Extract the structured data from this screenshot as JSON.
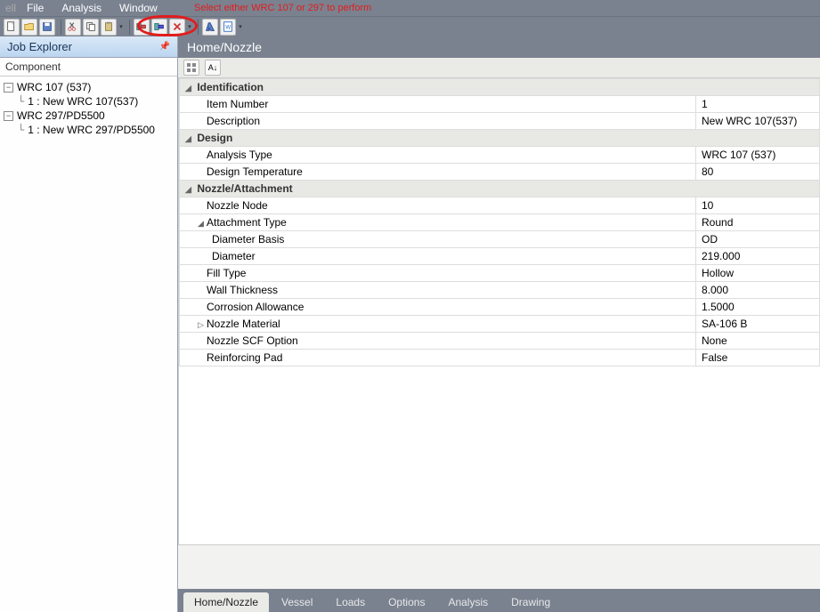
{
  "menu": {
    "items": [
      "File",
      "Analysis",
      "Window"
    ],
    "prefix": "ell"
  },
  "overlay_text": "Select either WRC 107 or 297 to perform",
  "job_explorer": {
    "title": "Job Explorer",
    "component_label": "Component",
    "nodes": [
      {
        "label": "WRC 107 (537)",
        "child": "1 : New WRC 107(537)"
      },
      {
        "label": "WRC 297/PD5500",
        "child": "1 : New WRC 297/PD5500"
      }
    ]
  },
  "content": {
    "title": "Home/Nozzle",
    "groups": [
      {
        "name": "Identification",
        "rows": [
          {
            "label": "Item Number",
            "value": "1"
          },
          {
            "label": "Description",
            "value": "New WRC 107(537)"
          }
        ]
      },
      {
        "name": "Design",
        "rows": [
          {
            "label": "Analysis Type",
            "value": "WRC 107 (537)"
          },
          {
            "label": "Design Temperature",
            "value": "80"
          }
        ]
      },
      {
        "name": "Nozzle/Attachment",
        "rows": [
          {
            "label": "Nozzle Node",
            "value": "10"
          },
          {
            "label": "Attachment Type",
            "value": "Round",
            "expandable": true,
            "sub": [
              {
                "label": "Diameter Basis",
                "value": "OD"
              },
              {
                "label": "Diameter",
                "value": "219.000"
              }
            ]
          },
          {
            "label": "Fill Type",
            "value": "Hollow"
          },
          {
            "label": "Wall Thickness",
            "value": "8.000"
          },
          {
            "label": "Corrosion Allowance",
            "value": "1.5000"
          },
          {
            "label": "Nozzle Material",
            "value": "SA-106 B",
            "expandable": true,
            "collapsed": true
          },
          {
            "label": "Nozzle SCF Option",
            "value": "None"
          },
          {
            "label": "Reinforcing Pad",
            "value": "False"
          }
        ]
      }
    ]
  },
  "tabs": [
    "Home/Nozzle",
    "Vessel",
    "Loads",
    "Options",
    "Analysis",
    "Drawing"
  ],
  "active_tab": 0
}
